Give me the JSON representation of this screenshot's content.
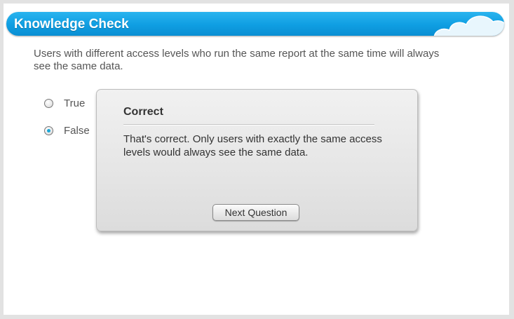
{
  "header": {
    "title": "Knowledge Check",
    "decoration_icon": "cloud-icon"
  },
  "question": {
    "text": "Users with different access levels who run the same report at the same time will always see the same data.",
    "options": [
      {
        "label": "True",
        "selected": false
      },
      {
        "label": "False",
        "selected": true
      }
    ]
  },
  "feedback": {
    "title": "Correct",
    "message": "That's correct. Only users with exactly the same access levels would always see the same data.",
    "next_label": "Next Question"
  },
  "colors": {
    "header_blue": "#0f9ee2",
    "selected_radio": "#19a6d6",
    "text": "#555555"
  }
}
